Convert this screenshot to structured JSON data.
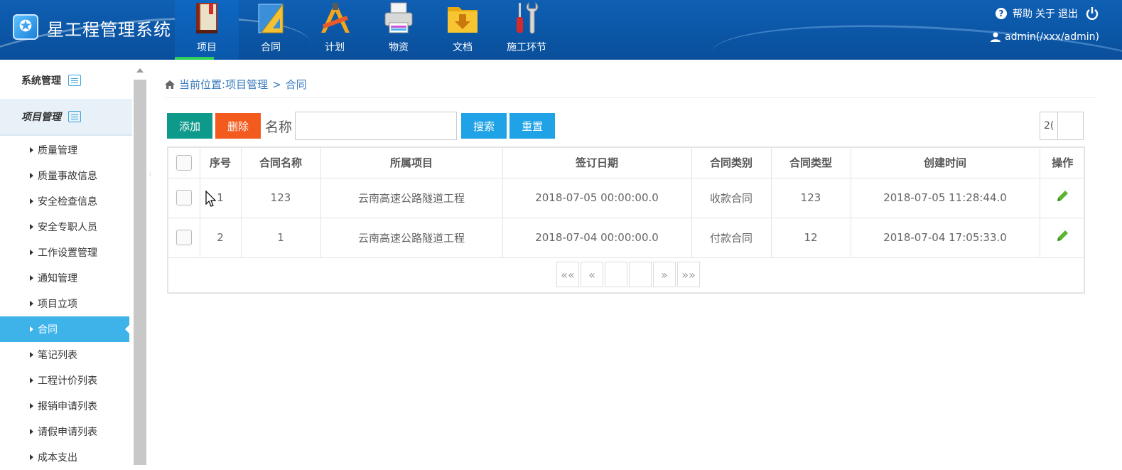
{
  "header": {
    "logo_glyph": "✪",
    "app_title": "星工程管理系统",
    "nav": [
      {
        "label": "项目",
        "icon": "book-icon",
        "active": true
      },
      {
        "label": "合同",
        "icon": "ruler-triangle-icon",
        "active": false
      },
      {
        "label": "计划",
        "icon": "pencil-ruler-icon",
        "active": false
      },
      {
        "label": "物资",
        "icon": "printer-icon",
        "active": false
      },
      {
        "label": "文档",
        "icon": "folder-download-icon",
        "active": false
      },
      {
        "label": "施工环节",
        "icon": "tools-icon",
        "active": false
      }
    ],
    "help_glyph": "?",
    "help": "帮助",
    "about": "关于",
    "logout": "退出",
    "user": "admin(/xxx/admin)"
  },
  "sidebar": {
    "group_system": "系统管理",
    "group_project": "项目管理",
    "items": [
      {
        "label": "质量管理"
      },
      {
        "label": "质量事故信息"
      },
      {
        "label": "安全检查信息"
      },
      {
        "label": "安全专职人员"
      },
      {
        "label": "工作设置管理"
      },
      {
        "label": "通知管理"
      },
      {
        "label": "项目立项"
      },
      {
        "label": "合同",
        "active": true
      },
      {
        "label": "笔记列表"
      },
      {
        "label": "工程计价列表"
      },
      {
        "label": "报销申请列表"
      },
      {
        "label": "请假申请列表"
      },
      {
        "label": "成本支出"
      }
    ],
    "splitter_glyph": "⁞"
  },
  "breadcrumb": {
    "prefix": "当前位置:",
    "section": "项目管理",
    "separator": ">",
    "current": "合同"
  },
  "toolbar": {
    "add": "添加",
    "delete": "删除",
    "name_label": "名称",
    "name_value": "",
    "search": "搜索",
    "reset": "重置",
    "page_size": "2("
  },
  "table": {
    "columns": [
      "序号",
      "合同名称",
      "所属项目",
      "签订日期",
      "合同类别",
      "合同类型",
      "创建时间",
      "操作"
    ],
    "rows": [
      {
        "no": "1",
        "name": "123",
        "project": "云南高速公路隧道工程",
        "sign_date": "2018-07-05 00:00:00.0",
        "category": "收款合同",
        "type": "123",
        "created": "2018-07-05 11:28:44.0"
      },
      {
        "no": "2",
        "name": "1",
        "project": "云南高速公路隧道工程",
        "sign_date": "2018-07-04 00:00:00.0",
        "category": "付款合同",
        "type": "12",
        "created": "2018-07-04 17:05:33.0"
      }
    ]
  },
  "pager": {
    "first": "««",
    "prev": "«",
    "current_page": "",
    "total": "",
    "next": "»",
    "last": "»»"
  },
  "colors": {
    "header_bg": "#0b56a6",
    "accent": "#3db3ea",
    "add": "#0e9a8b",
    "delete": "#f25a1e",
    "search": "#1fa2e6",
    "edit": "#5cb531"
  }
}
